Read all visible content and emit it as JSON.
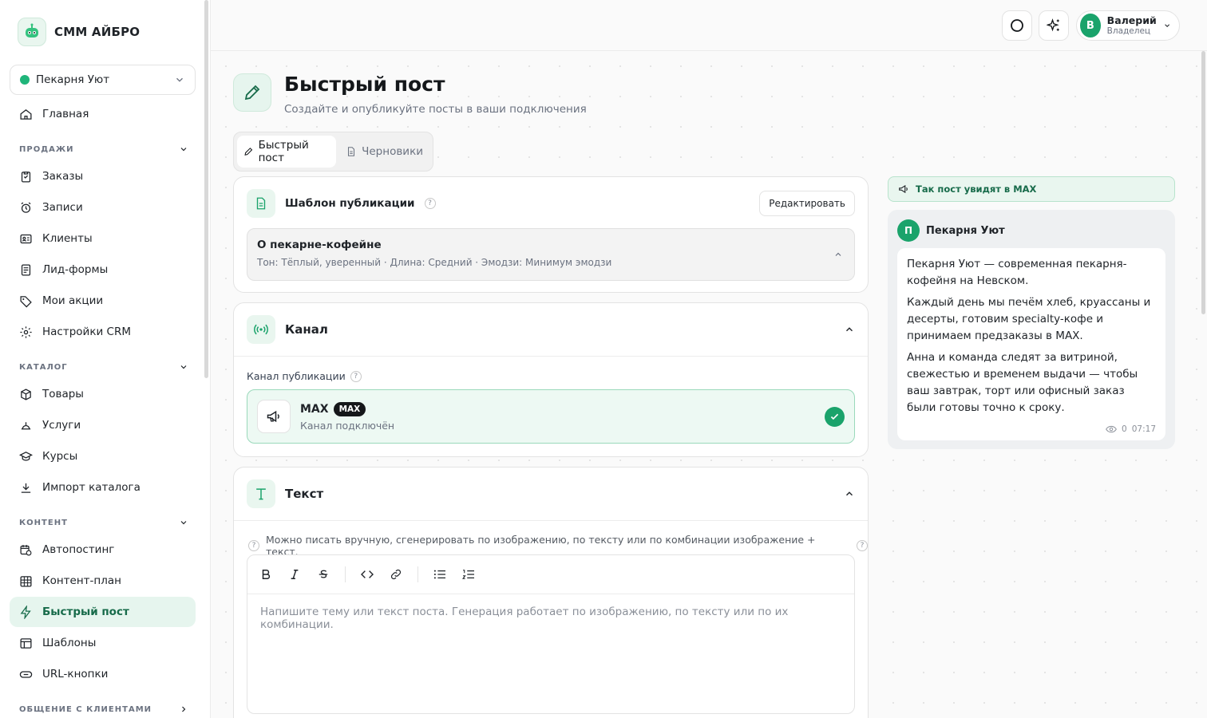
{
  "brand": {
    "name": "СММ АЙБРО"
  },
  "business": {
    "name": "Пекарня Уют"
  },
  "nav": {
    "home": "Главная",
    "sections": {
      "sales": "ПРОДАЖИ",
      "catalog": "КАТАЛОГ",
      "content": "КОНТЕНТ",
      "communication": "ОБЩЕНИЕ С КЛИЕНТАМИ"
    },
    "sales_items": [
      "Заказы",
      "Записи",
      "Клиенты",
      "Лид-формы",
      "Мои акции",
      "Настройки CRM"
    ],
    "catalog_items": [
      "Товары",
      "Услуги",
      "Курсы",
      "Импорт каталога"
    ],
    "content_items": [
      "Автопостинг",
      "Контент-план",
      "Быстрый пост",
      "Шаблоны",
      "URL-кнопки"
    ]
  },
  "user": {
    "initial": "В",
    "name": "Валерий",
    "role": "Владелец"
  },
  "page": {
    "title": "Быстрый пост",
    "subtitle": "Создайте и опубликуйте посты в ваши подключения"
  },
  "tabs": {
    "quick": "Быстрый пост",
    "drafts": "Черновики"
  },
  "template_card": {
    "title": "Шаблон публикации",
    "help": "?",
    "edit_label": "Редактировать",
    "selected_name": "О пекарне-кофейне",
    "selected_meta": "Тон: Тёплый, уверенный · Длина: Средний · Эмодзи: Минимум эмодзи"
  },
  "channel_card": {
    "title": "Канал",
    "field_label": "Канал публикации",
    "help": "?",
    "channel_name": "MAX",
    "channel_badge": "MAX",
    "channel_status": "Канал подключён"
  },
  "text_card": {
    "title": "Текст",
    "hint": "Можно писать вручную, сгенерировать по изображению, по тексту или по комбинации изображение + текст.",
    "help": "?",
    "placeholder": "Напишите тему или текст поста. Генерация работает по изображению, по тексту или по их комбинации."
  },
  "preview": {
    "tag": "Так пост увидят в MAX",
    "avatar": "П",
    "name": "Пекарня Уют",
    "paragraphs": [
      "Пекарня Уют — современная пекарня-кофейня на Невском.",
      "Каждый день мы печём хлеб, круассаны и десерты, готовим specialty-кофе и принимаем предзаказы в MAX.",
      "Анна и команда следят за витриной, свежестью и временем выдачи — чтобы ваш завтрак, торт или офисный заказ были готовы точно к сроку."
    ],
    "views": "0",
    "time": "07:17"
  },
  "colors": {
    "accent": "#1aa36b",
    "accent_soft": "#e6f5ee",
    "text": "#1f2328"
  }
}
